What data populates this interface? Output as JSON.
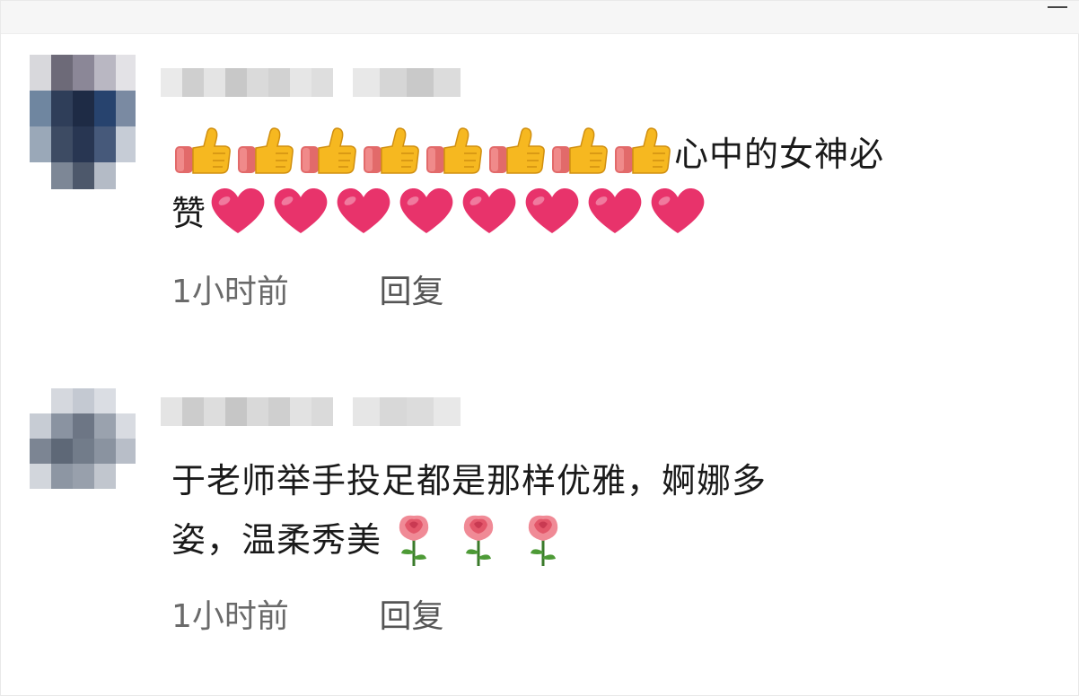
{
  "comments": [
    {
      "text_lines": [
        "心中的女神必",
        "赞"
      ],
      "time": "1小时前",
      "reply_label": "回复",
      "icons": {
        "thumbs_up_count": 8,
        "heart_count": 8
      }
    },
    {
      "text_lines": [
        "于老师举手投足都是那样优雅，婀娜多",
        "姿，温柔秀美"
      ],
      "time": "1小时前",
      "reply_label": "回复",
      "icons": {
        "rose_count": 3
      }
    }
  ],
  "icon_names": {
    "thumbs_up": "thumbs-up-icon",
    "heart": "heart-icon",
    "rose": "rose-icon"
  },
  "colors": {
    "meta_text": "#6a6a6a",
    "heart": "#e8336b",
    "thumb": "#f6b820",
    "sleeve": "#e26a6a"
  }
}
